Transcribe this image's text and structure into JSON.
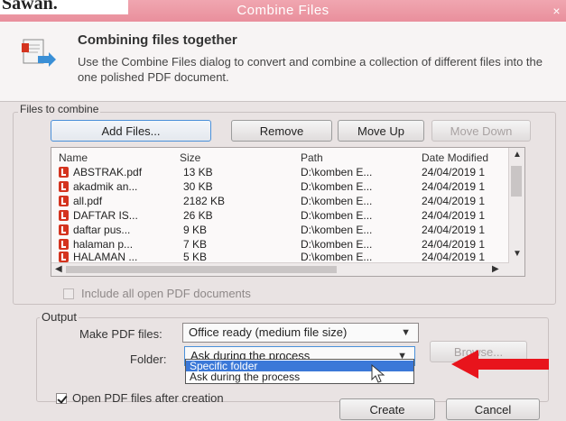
{
  "page_heading": "Sawan.",
  "window": {
    "title": "Combine Files",
    "close": "×"
  },
  "header": {
    "title": "Combining files together",
    "description": "Use the Combine Files dialog to convert and combine a collection of different files into the one polished PDF document."
  },
  "files_group": {
    "label": "Files to combine",
    "add_files": "Add Files...",
    "remove": "Remove",
    "move_up": "Move Up",
    "move_down": "Move Down",
    "columns": {
      "name": "Name",
      "size": "Size",
      "path": "Path",
      "date": "Date Modified"
    },
    "rows": [
      {
        "name": "ABSTRAK.pdf",
        "size": "13 KB",
        "path": "D:\\komben E...",
        "date": "24/04/2019 1"
      },
      {
        "name": "akadmik an...",
        "size": "30 KB",
        "path": "D:\\komben E...",
        "date": "24/04/2019 1"
      },
      {
        "name": "all.pdf",
        "size": "2182 KB",
        "path": "D:\\komben E...",
        "date": "24/04/2019 1"
      },
      {
        "name": "DAFTAR IS...",
        "size": "26 KB",
        "path": "D:\\komben E...",
        "date": "24/04/2019 1"
      },
      {
        "name": "daftar pus...",
        "size": "9 KB",
        "path": "D:\\komben E...",
        "date": "24/04/2019 1"
      },
      {
        "name": "halaman p...",
        "size": "7 KB",
        "path": "D:\\komben E...",
        "date": "24/04/2019 1"
      },
      {
        "name": "HALAMAN ...",
        "size": "5 KB",
        "path": "D:\\komben E...",
        "date": "24/04/2019 1"
      }
    ],
    "include_open": "Include all open PDF documents"
  },
  "output": {
    "label": "Output",
    "make_pdf_label": "Make PDF files:",
    "make_pdf_value": "Office ready (medium file size)",
    "folder_label": "Folder:",
    "folder_value": "Ask during the process",
    "browse": "Browse...",
    "folder_options": [
      "Specific folder",
      "Ask during the process"
    ]
  },
  "footer": {
    "open_after": "Open PDF files after creation",
    "create": "Create",
    "cancel": "Cancel"
  },
  "colors": {
    "accent": "#3b78d8",
    "annotation_arrow": "#e8141c",
    "titlebar": "#e98f9c"
  }
}
